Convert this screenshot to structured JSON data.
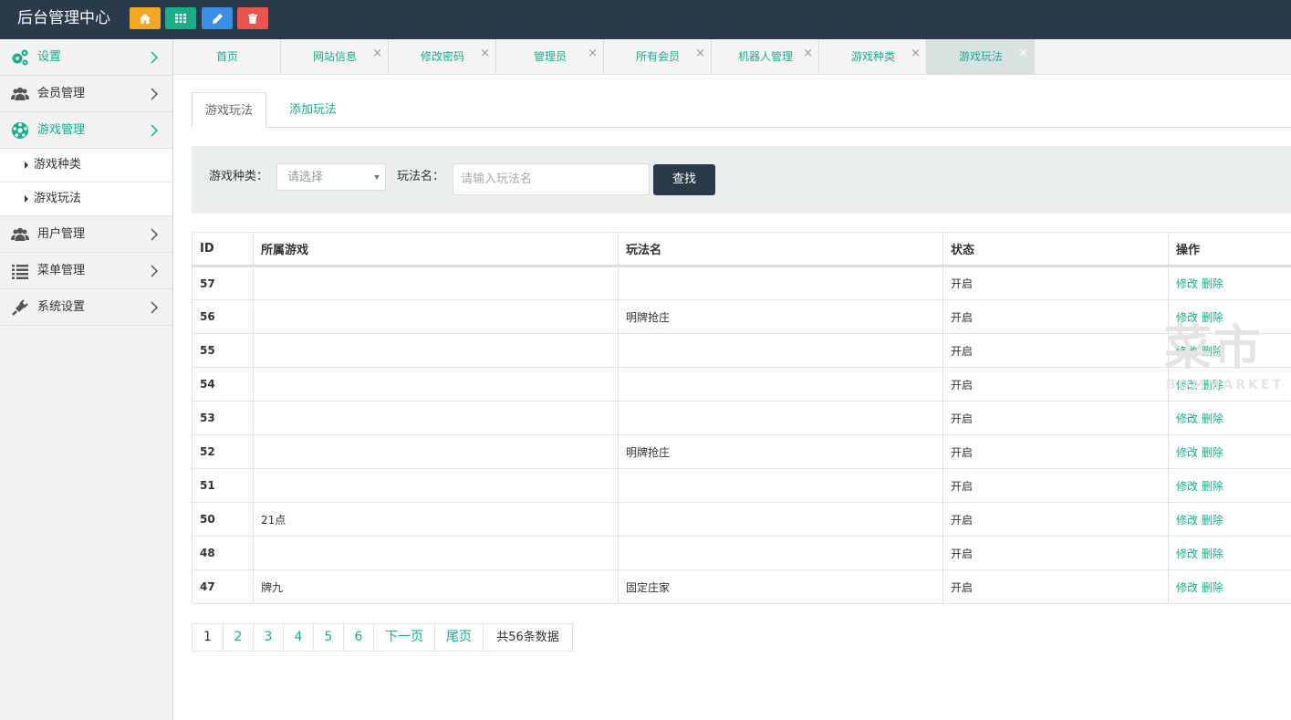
{
  "header": {
    "title": "后台管理中心",
    "buttons": [
      {
        "icon": "home-icon",
        "color": "#f5a623"
      },
      {
        "icon": "grid-icon",
        "color": "#1aae88"
      },
      {
        "icon": "edit-icon",
        "color": "#3a8ee6"
      },
      {
        "icon": "trash-icon",
        "color": "#e8554e"
      }
    ]
  },
  "sidebar": {
    "items": [
      {
        "label": "设置",
        "icon": "gears-icon"
      },
      {
        "label": "会员管理",
        "icon": "users-icon"
      },
      {
        "label": "游戏管理",
        "icon": "soccer-icon"
      },
      {
        "label": "用户管理",
        "icon": "users-icon"
      },
      {
        "label": "菜单管理",
        "icon": "list-icon"
      },
      {
        "label": "系统设置",
        "icon": "plug-icon"
      }
    ],
    "subitems": [
      {
        "label": "游戏种类"
      },
      {
        "label": "游戏玩法"
      }
    ]
  },
  "page_tabs": [
    {
      "label": "首页"
    },
    {
      "label": "网站信息"
    },
    {
      "label": "修改密码"
    },
    {
      "label": "管理员"
    },
    {
      "label": "所有会员"
    },
    {
      "label": "机器人管理"
    },
    {
      "label": "游戏种类"
    },
    {
      "label": "游戏玩法"
    }
  ],
  "inner_tabs": {
    "active": "游戏玩法",
    "add": "添加玩法"
  },
  "search": {
    "category_label": "游戏种类：",
    "category_placeholder": "请选择",
    "name_label": "玩法名：",
    "name_placeholder": "请输入玩法名",
    "button": "查找"
  },
  "table": {
    "columns": [
      "ID",
      "所属游戏",
      "玩法名",
      "状态",
      "操作"
    ],
    "rows": [
      {
        "id": "57",
        "game": "",
        "name": "",
        "status": "开启"
      },
      {
        "id": "56",
        "game": "",
        "name": "明牌抢庄",
        "status": "开启"
      },
      {
        "id": "55",
        "game": "",
        "name": "",
        "status": "开启"
      },
      {
        "id": "54",
        "game": "",
        "name": "",
        "status": "开启"
      },
      {
        "id": "53",
        "game": "",
        "name": "",
        "status": "开启"
      },
      {
        "id": "52",
        "game": "",
        "name": "明牌抢庄",
        "status": "开启"
      },
      {
        "id": "51",
        "game": "",
        "name": "",
        "status": "开启"
      },
      {
        "id": "50",
        "game": "21点",
        "name": "",
        "status": "开启"
      },
      {
        "id": "48",
        "game": "",
        "name": "",
        "status": "开启"
      },
      {
        "id": "47",
        "game": "牌九",
        "name": "固定庄家",
        "status": "开启"
      }
    ],
    "edit_label": "修改",
    "delete_label": "删除"
  },
  "pagination": {
    "pages": [
      "1",
      "2",
      "3",
      "4",
      "5",
      "6"
    ],
    "next": "下一页",
    "last": "尾页",
    "total": "共56条数据"
  },
  "watermark": {
    "main": "菜市",
    "sub": "BOMMARKET"
  },
  "colors": {
    "accent": "#1aae88",
    "topbar": "#2b3a4a",
    "search_button": "#2b3a4a"
  }
}
